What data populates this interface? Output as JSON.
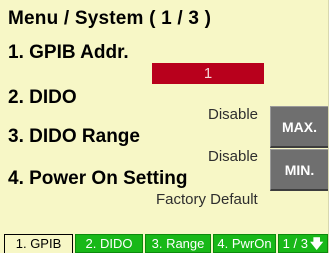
{
  "menu": {
    "title": "Menu / System ( 1 / 3 )"
  },
  "items": [
    {
      "label": "1. GPIB Addr.",
      "value": "1"
    },
    {
      "label": "2. DIDO",
      "value": "Disable"
    },
    {
      "label": "3. DIDO Range",
      "value": "Disable"
    },
    {
      "label": "4. Power On Setting",
      "value": "Factory Default"
    }
  ],
  "softkeys": {
    "max_label": "MAX.",
    "min_label": "MIN."
  },
  "tabs": [
    {
      "label": "1. GPIB",
      "active": true
    },
    {
      "label": "2. DIDO",
      "active": false
    },
    {
      "label": "3. Range",
      "active": false
    },
    {
      "label": "4. PwrOn",
      "active": false
    },
    {
      "label": "1 / 3",
      "active": false,
      "icon": "arrow-down-icon"
    }
  ],
  "colors": {
    "background": "#f7f7c6",
    "selected_value_bg": "#b8001c",
    "softkey_bg": "#6f6f6f",
    "tab_green": "#18b818"
  }
}
